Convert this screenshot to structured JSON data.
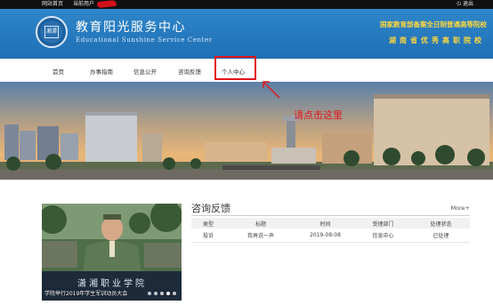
{
  "topbar": {
    "site_home": "网站首页",
    "current_user": "当前用户",
    "logout": "退出"
  },
  "header": {
    "emblem_text": "湘潭",
    "title_cn": "教育阳光服务中心",
    "title_en": "Educational Sunshine Service Center",
    "slogan_1": "国家教育部备案全日制普通高等院校",
    "slogan_2": "湖南省优秀高职院校"
  },
  "nav": {
    "items": [
      "首页",
      "办事指南",
      "信息公开",
      "咨询反馈",
      "个人中心"
    ]
  },
  "annotation": {
    "text": "请点击这里"
  },
  "photo": {
    "caption": "学院举行2019年学生军训动员大会",
    "sign_text": "潇湘职业学院",
    "slide_count": 5
  },
  "panel": {
    "title": "咨询反馈",
    "more": "More+",
    "columns": [
      "类型",
      "标题",
      "时间",
      "受理部门",
      "处理状态"
    ],
    "rows": [
      [
        "投诉",
        "我再说一声",
        "2019-08-08",
        "信息中心",
        "已处理"
      ]
    ]
  },
  "colors": {
    "header_blue": "#2277bb",
    "slogan_yellow": "#ffd83a",
    "highlight_red": "#e3141c"
  },
  "icons": {
    "logout": "power-icon"
  }
}
